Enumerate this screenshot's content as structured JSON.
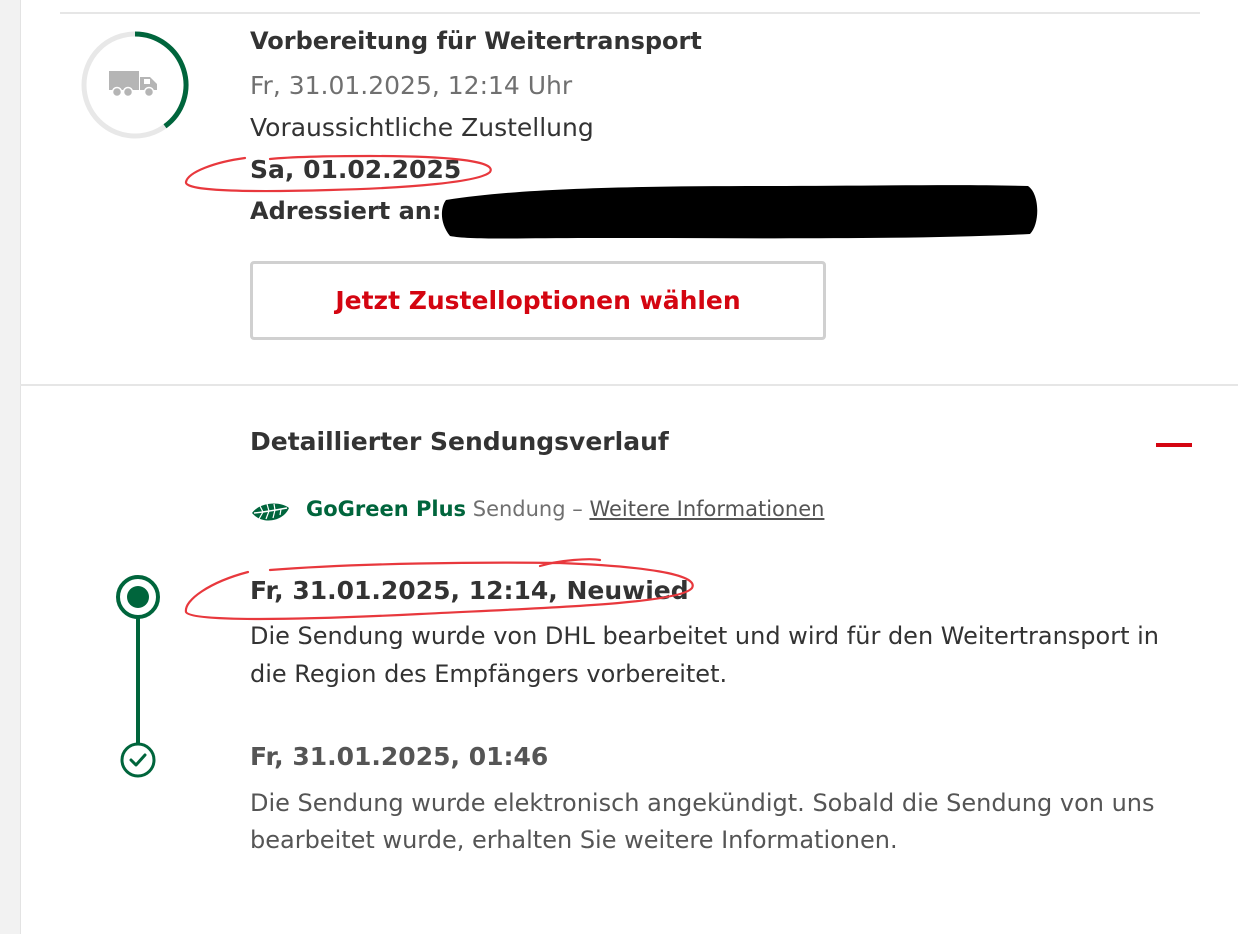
{
  "shipment": {
    "status_title": "Vorbereitung für Weitertransport",
    "status_time": "Fr, 31.01.2025, 12:14 Uhr",
    "estimated_label": "Voraussichtliche Zustellung",
    "estimated_date": "Sa, 01.02.2025",
    "addressed_label": "Adressiert an:",
    "progress_fraction": 0.4,
    "status_icon": "truck-icon"
  },
  "cta": {
    "label": "Jetzt Zustelloptionen wählen"
  },
  "history": {
    "title": "Detaillierter Sendungsverlauf",
    "collapse_icon": "minus-icon",
    "gogreen": {
      "brand": "GoGreen Plus",
      "text": "Sendung –",
      "link": "Weitere Informationen",
      "icon": "leaf-icon"
    },
    "events": [
      {
        "heading": "Fr, 31.01.2025, 12:14, Neuwied",
        "line1": "Die Sendung wurde von DHL bearbeitet und wird für den Weitertransport in",
        "line2": "die Region des Empfängers vorbereitet."
      },
      {
        "heading": "Fr, 31.01.2025, 01:46",
        "line1": "Die Sendung wurde elektronisch angekündigt. Sobald die Sendung von uns",
        "line2": "bearbeitet wurde, erhalten Sie weitere Informationen."
      }
    ]
  },
  "colors": {
    "brand_red": "#d40511",
    "brand_green": "#00653c",
    "text_dark": "#333333",
    "text_muted": "#707070",
    "annotation_red": "#e8383d"
  }
}
